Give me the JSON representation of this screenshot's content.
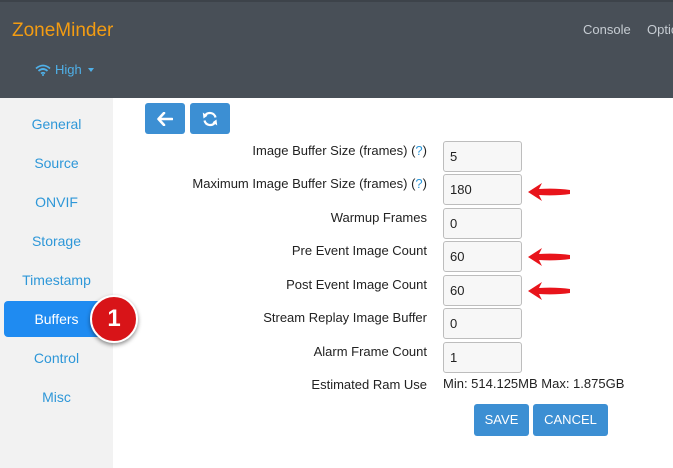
{
  "header": {
    "brand": "ZoneMinder",
    "links": [
      "Console",
      "Optio"
    ],
    "bandwidth_label": "High"
  },
  "sidebar": {
    "items": [
      {
        "label": "General"
      },
      {
        "label": "Source"
      },
      {
        "label": "ONVIF"
      },
      {
        "label": "Storage"
      },
      {
        "label": "Timestamp"
      },
      {
        "label": "Buffers",
        "active": true
      },
      {
        "label": "Control"
      },
      {
        "label": "Misc"
      }
    ]
  },
  "annotation": {
    "badge": "1",
    "arrow_color": "#e8141b"
  },
  "form": {
    "help_glyph": "?",
    "fields": [
      {
        "label": "Image Buffer Size (frames)",
        "value": "5"
      },
      {
        "label": "Maximum Image Buffer Size (frames)",
        "value": "180"
      },
      {
        "label": "Warmup Frames",
        "value": "0"
      },
      {
        "label": "Pre Event Image Count",
        "value": "60"
      },
      {
        "label": "Post Event Image Count",
        "value": "60"
      },
      {
        "label": "Stream Replay Image Buffer",
        "value": "0"
      },
      {
        "label": "Alarm Frame Count",
        "value": "1"
      }
    ],
    "ram_label": "Estimated Ram Use",
    "ram_value": "Min: 514.125MB Max: 1.875GB"
  },
  "buttons": {
    "save": "SAVE",
    "cancel": "CANCEL"
  },
  "colors": {
    "brand": "#f39c12",
    "accent": "#3c8fd3",
    "active_tab": "#1f8bf1",
    "link": "#2e97d8"
  }
}
